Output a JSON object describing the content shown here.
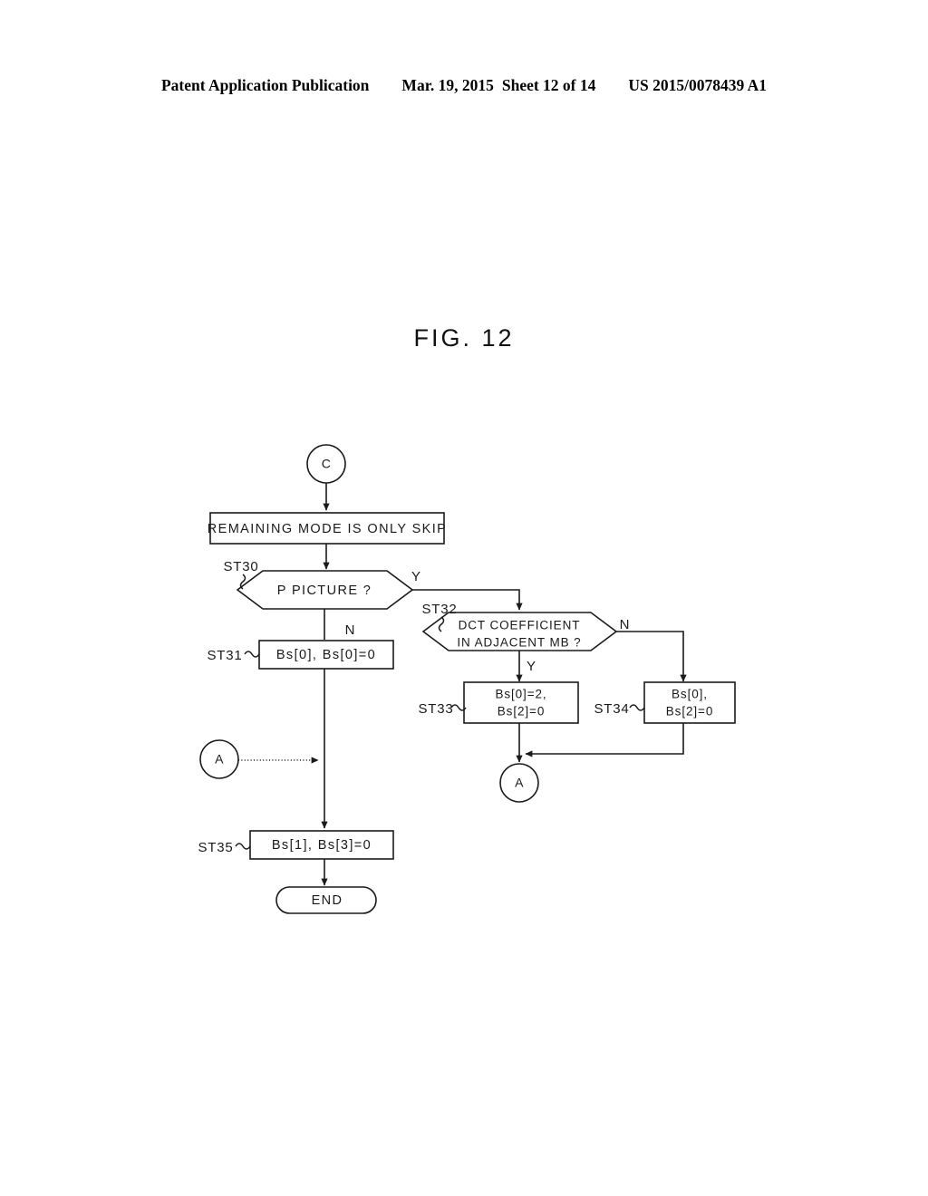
{
  "header": {
    "publication": "Patent Application Publication",
    "date": "Mar. 19, 2015",
    "sheet": "Sheet 12 of 14",
    "patent_number": "US 2015/0078439 A1"
  },
  "figure": {
    "title": "FIG. 12"
  },
  "flowchart": {
    "nodes": {
      "start_connector": {
        "label": "C"
      },
      "remaining_mode": {
        "label": "REMAINING MODE IS ONLY SKIP"
      },
      "st30": {
        "step": "ST30",
        "label": "P PICTURE ?"
      },
      "st31": {
        "step": "ST31",
        "label": "Bs[0], Bs[0]=0"
      },
      "st32": {
        "step": "ST32",
        "line1": "DCT COEFFICIENT",
        "line2": "IN ADJACENT MB ?"
      },
      "st33": {
        "step": "ST33",
        "line1": "Bs[0]=2,",
        "line2": "Bs[2]=0"
      },
      "st34": {
        "step": "ST34",
        "line1": "Bs[0],",
        "line2": "Bs[2]=0"
      },
      "st35": {
        "step": "ST35",
        "label": "Bs[1], Bs[3]=0"
      },
      "connector_a_in": {
        "label": "A"
      },
      "connector_a_out": {
        "label": "A"
      },
      "end": {
        "label": "END"
      }
    },
    "branches": {
      "st30_yes": "Y",
      "st30_no": "N",
      "st32_yes": "Y",
      "st32_no": "N"
    },
    "colors": {
      "ink": "#1a1a1a",
      "paper": "#ffffff"
    }
  }
}
